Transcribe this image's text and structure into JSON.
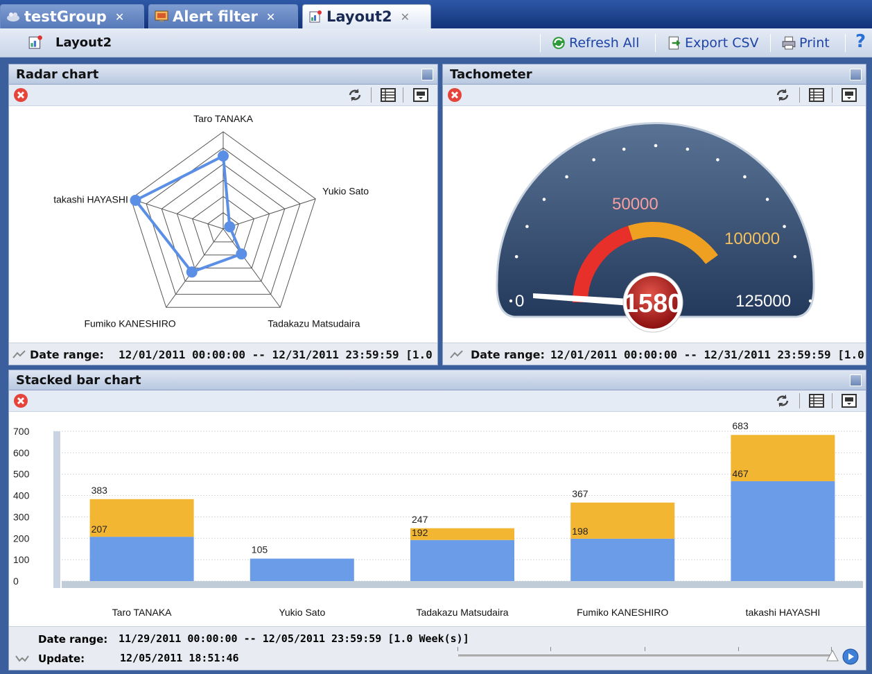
{
  "tabs": [
    {
      "label": "testGroup",
      "active": false
    },
    {
      "label": "Alert filter",
      "active": false
    },
    {
      "label": "Layout2",
      "active": true
    }
  ],
  "toolbar": {
    "title": "Layout2",
    "refresh_label": "Refresh All",
    "export_label": "Export CSV",
    "print_label": "Print",
    "help_label": "?"
  },
  "radar": {
    "title": "Radar chart",
    "footer_label": "Date range:",
    "footer_value": "12/01/2011 00:00:00 -- 12/31/2011 23:59:59 [1.0"
  },
  "tacho": {
    "title": "Tachometer",
    "footer_label": "Date range:",
    "footer_value": "12/01/2011 00:00:00 -- 12/31/2011 23:59:59 [1.0",
    "value_text": "1580",
    "scale_labels": [
      "0",
      "50000",
      "100000",
      "125000"
    ],
    "colors": {
      "red": "#e8302a",
      "orange": "#f0a020",
      "dial": "#2e4a6e"
    }
  },
  "stacked": {
    "title": "Stacked bar chart",
    "footer_range_label": "Date range:",
    "footer_range_value": "11/29/2011 00:00:00 -- 12/05/2011 23:59:59 [1.0 Week(s)]",
    "footer_update_label": "Update:",
    "footer_update_value": "12/05/2011 18:51:46"
  },
  "chart_data": [
    {
      "type": "radar",
      "categories": [
        "Taro TANAKA",
        "Yukio Sato",
        "Tadakazu Matsudaira",
        "Fumiko KANESHIRO",
        "takashi HAYASHI"
      ],
      "values": [
        0.75,
        0.07,
        0.32,
        0.55,
        0.95
      ],
      "rings": 6,
      "color": "#5b8fe6"
    },
    {
      "type": "gauge",
      "value": 1580,
      "min": 0,
      "max": 125000,
      "tick_labels": [
        "0",
        "50000",
        "100000",
        "125000"
      ],
      "bands": [
        {
          "from": 0,
          "to": 50000,
          "color": "#e8302a"
        },
        {
          "from": 50000,
          "to": 100000,
          "color": "#f0a020"
        }
      ]
    },
    {
      "type": "bar",
      "stacked": true,
      "categories": [
        "Taro TANAKA",
        "Yukio Sato",
        "Tadakazu Matsudaira",
        "Fumiko KANESHIRO",
        "takashi HAYASHI"
      ],
      "series": [
        {
          "values": [
            207,
            105,
            192,
            198,
            467
          ],
          "color": "#6b9ce8"
        },
        {
          "values": [
            176,
            0,
            55,
            169,
            216
          ],
          "color": "#f2b632"
        }
      ],
      "data_labels": [
        {
          "total": "383",
          "base": "207"
        },
        {
          "total": "105",
          "base": ""
        },
        {
          "total": "247",
          "base": "192"
        },
        {
          "total": "367",
          "base": "198"
        },
        {
          "total": "683",
          "base": "467"
        }
      ],
      "ylim": [
        0,
        700
      ],
      "yticks": [
        "0",
        "100",
        "200",
        "300",
        "400",
        "500",
        "600",
        "700"
      ],
      "grid": true
    }
  ]
}
